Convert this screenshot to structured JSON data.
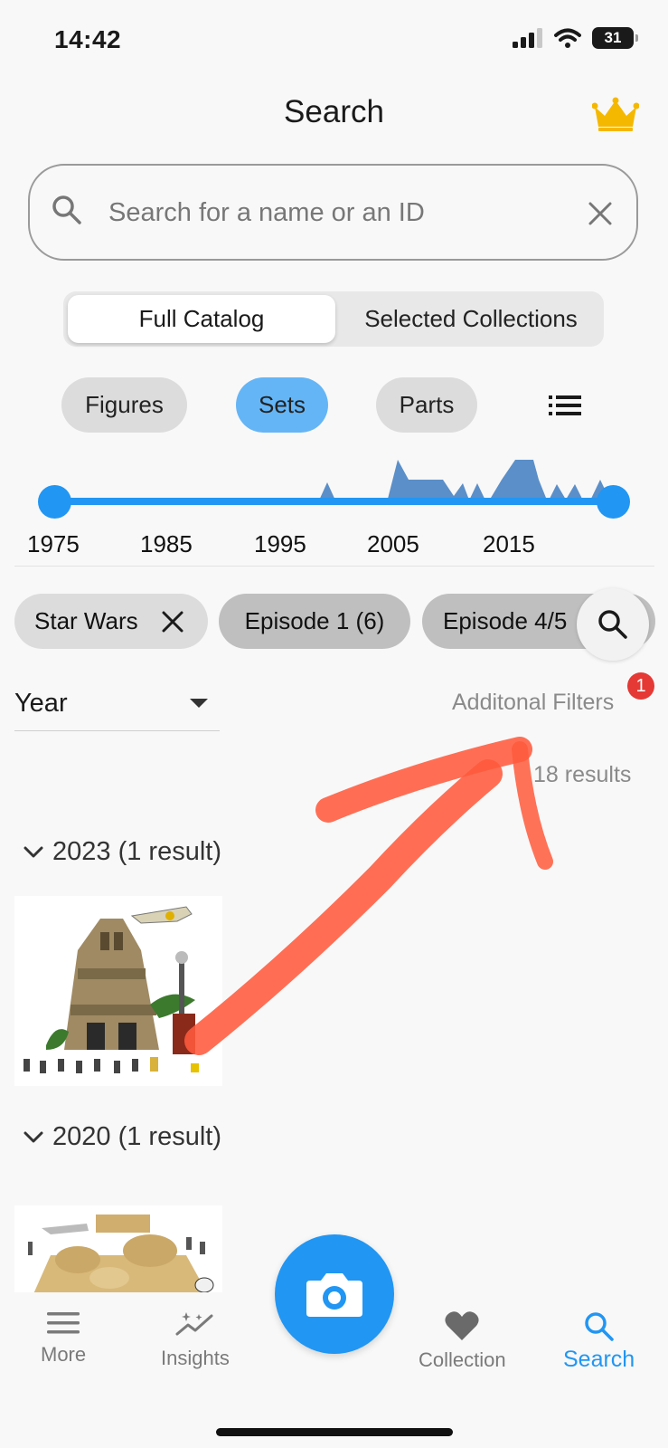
{
  "status_bar": {
    "time": "14:42",
    "battery": "31"
  },
  "header": {
    "title": "Search"
  },
  "search": {
    "placeholder": "Search for a name or an ID"
  },
  "catalog_toggle": {
    "options": [
      "Full Catalog",
      "Selected Collections"
    ],
    "selected": "Full Catalog"
  },
  "type_chips": [
    {
      "label": "Figures",
      "selected": false
    },
    {
      "label": "Sets",
      "selected": true
    },
    {
      "label": "Parts",
      "selected": false
    }
  ],
  "timeline": {
    "year_labels": [
      "1975",
      "1985",
      "1995",
      "2005",
      "2015"
    ]
  },
  "filter_chips": [
    {
      "label": "Star Wars",
      "removable": true
    },
    {
      "label": "Episode 1 (6)",
      "removable": false
    },
    {
      "label": "Episode 4/5",
      "removable": false
    }
  ],
  "sort": {
    "label": "Year"
  },
  "additional_filters": {
    "label": "Additonal Filters",
    "badge": "1"
  },
  "results": {
    "count_text": "18 results",
    "groups": [
      {
        "header": "2023 (1 result)"
      },
      {
        "header": "2020 (1 result)"
      }
    ]
  },
  "bottom_nav": {
    "items": [
      {
        "label": "More",
        "icon": "menu-icon"
      },
      {
        "label": "Insights",
        "icon": "insights-icon"
      },
      {
        "label": "Collection",
        "icon": "heart-icon"
      },
      {
        "label": "Search",
        "icon": "search-icon",
        "active": true
      }
    ]
  },
  "colors": {
    "accent": "#2196f3",
    "badge": "#e53935",
    "annotation": "#ff5a3c"
  }
}
